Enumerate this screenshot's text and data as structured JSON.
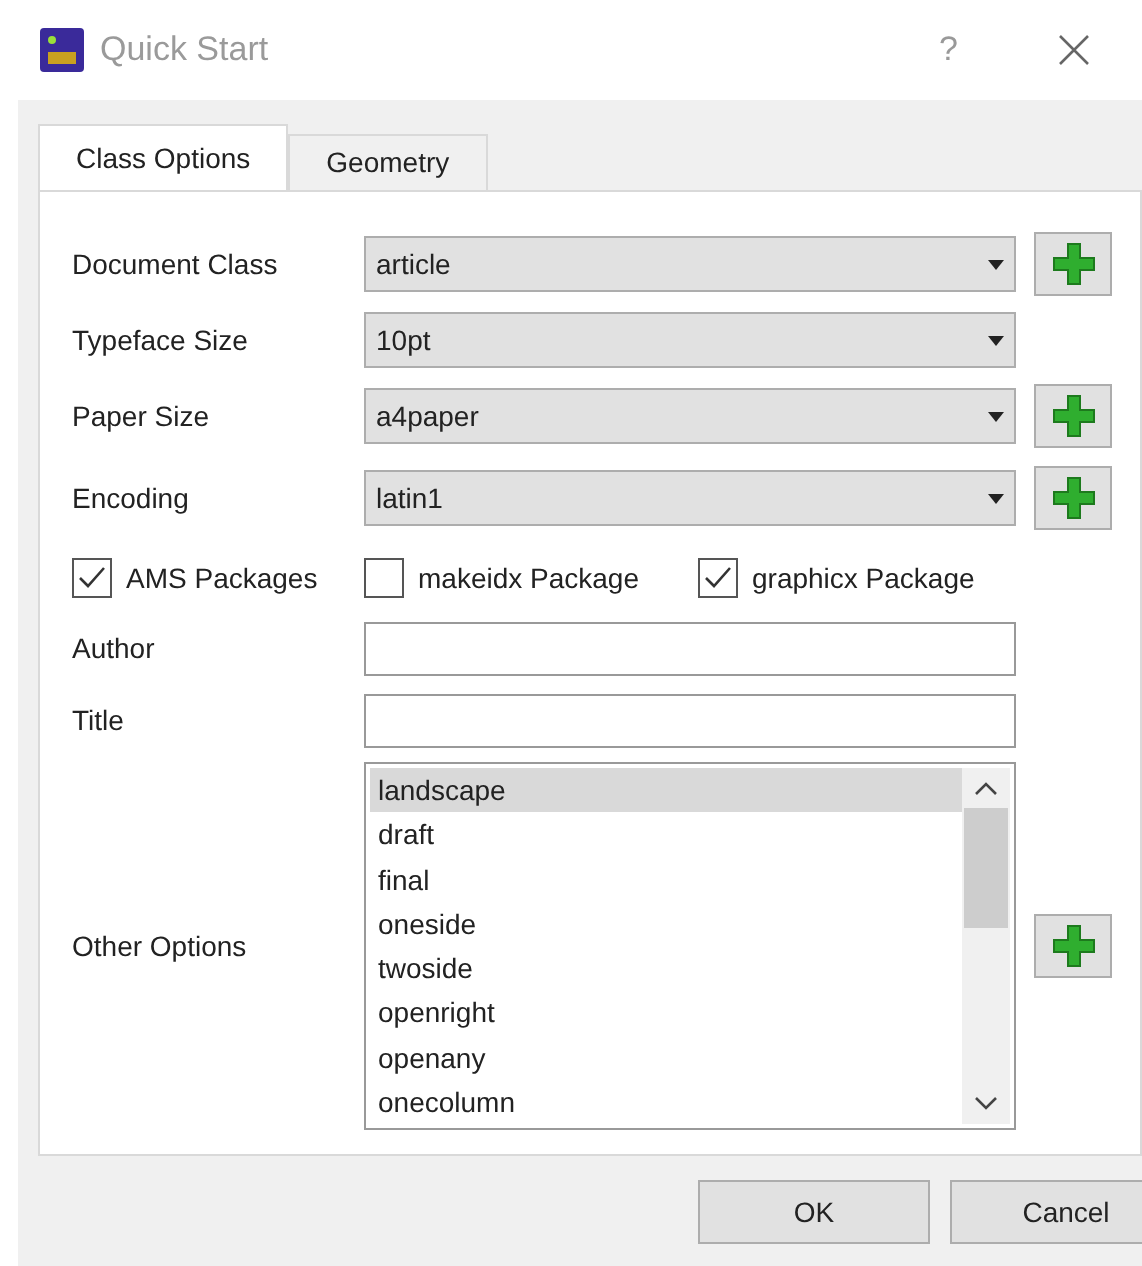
{
  "window": {
    "title": "Quick Start",
    "help": "?"
  },
  "tabs": [
    {
      "label": "Class Options",
      "selected": true
    },
    {
      "label": "Geometry",
      "selected": false
    }
  ],
  "combos": [
    {
      "label": "Document Class",
      "value": "article",
      "add_button": true
    },
    {
      "label": "Typeface Size",
      "value": "10pt",
      "add_button": false
    },
    {
      "label": "Paper Size",
      "value": "a4paper",
      "add_button": true
    },
    {
      "label": "Encoding",
      "value": "latin1",
      "add_button": true
    }
  ],
  "checkboxes": [
    {
      "label": "AMS Packages",
      "checked": true
    },
    {
      "label": "makeidx Package",
      "checked": false
    },
    {
      "label": "graphicx Package",
      "checked": true
    }
  ],
  "fields": [
    {
      "label": "Author"
    },
    {
      "label": "Title"
    }
  ],
  "other_options": {
    "label": "Other Options",
    "items": [
      {
        "text": "landscape",
        "selected": true
      },
      {
        "text": "draft",
        "selected": false
      },
      {
        "text": "final",
        "selected": false
      },
      {
        "text": "oneside",
        "selected": false
      },
      {
        "text": "twoside",
        "selected": false
      },
      {
        "text": "openright",
        "selected": false
      },
      {
        "text": "openany",
        "selected": false
      },
      {
        "text": "onecolumn",
        "selected": false
      }
    ]
  },
  "buttons": [
    "OK",
    "Cancel"
  ]
}
